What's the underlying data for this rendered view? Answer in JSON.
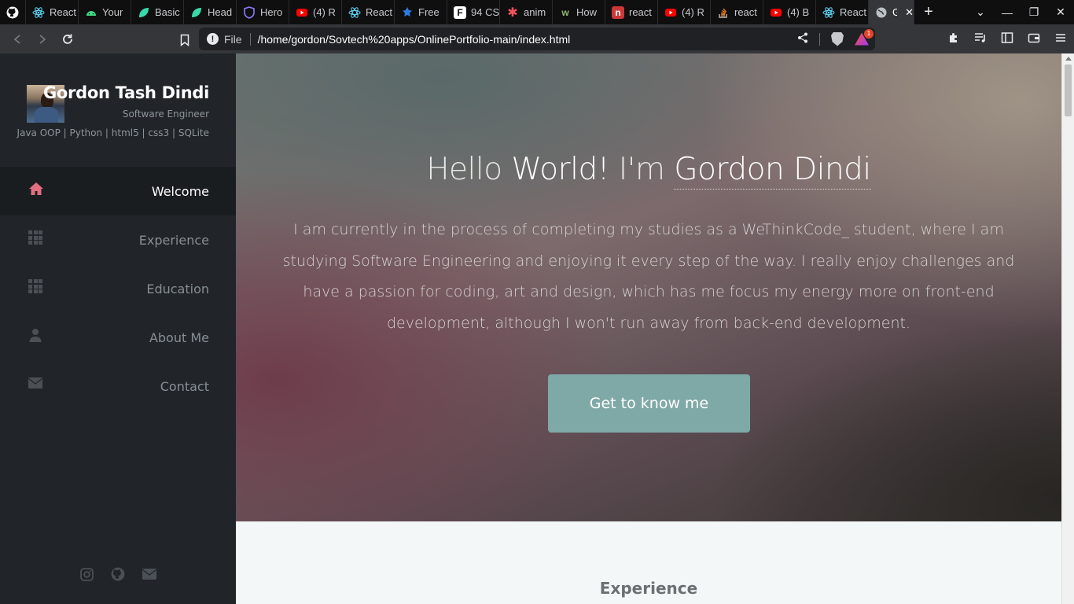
{
  "browser": {
    "tabs": [
      {
        "icon": "github-icon",
        "title": ""
      },
      {
        "icon": "react-icon",
        "title": "React"
      },
      {
        "icon": "android-icon",
        "title": "Your"
      },
      {
        "icon": "leaf-icon",
        "title": "Basic"
      },
      {
        "icon": "leaf-icon",
        "title": "Head"
      },
      {
        "icon": "shield-icon",
        "title": "Hero"
      },
      {
        "icon": "youtube-icon",
        "title": "(4) R"
      },
      {
        "icon": "react-icon",
        "title": "React"
      },
      {
        "icon": "free-icon",
        "title": "Free"
      },
      {
        "icon": "f-icon",
        "title": "94 CS"
      },
      {
        "icon": "asterisk-icon",
        "title": "anim"
      },
      {
        "icon": "wikihow-icon",
        "title": "How"
      },
      {
        "icon": "npm-icon",
        "title": "react"
      },
      {
        "icon": "youtube-icon",
        "title": "(4) R"
      },
      {
        "icon": "stackoverflow-icon",
        "title": "react"
      },
      {
        "icon": "youtube-icon",
        "title": "(4) B"
      },
      {
        "icon": "react-icon",
        "title": "React"
      },
      {
        "icon": "globe-icon",
        "title": "G",
        "active": true
      }
    ],
    "url_scheme_label": "File",
    "url": "/home/gordon/Sovtech%20apps/OnlinePortfolio-main/index.html",
    "rewards_badge": "1"
  },
  "sidebar": {
    "name": "Gordon Tash Dindi",
    "role": "Software Engineer",
    "skills": "Java OOP | Python | html5 | css3 | SQLite",
    "nav": [
      {
        "label": "Welcome",
        "icon": "home-icon",
        "active": true
      },
      {
        "label": "Experience",
        "icon": "grid-icon"
      },
      {
        "label": "Education",
        "icon": "grid-icon"
      },
      {
        "label": "About Me",
        "icon": "user-icon"
      },
      {
        "label": "Contact",
        "icon": "envelope-icon"
      }
    ],
    "socials": [
      "instagram-icon",
      "github-icon",
      "envelope-icon"
    ]
  },
  "hero": {
    "title_hello": "Hello",
    "title_world": "World!",
    "title_im": "I'm",
    "title_name": "Gordon Dindi",
    "text": "I am currently in the process of completing my studies as a WeThinkCode_ student, where I am studying Software Engineering and enjoying it every step of the way. I really enjoy challenges and have a passion for coding, art and design, which has me focus my energy more on front-end development, although I won't run away from back-end development.",
    "button": "Get to know me"
  },
  "next_section": {
    "title": "Experience"
  },
  "colors": {
    "sidebar_bg": "#212529",
    "accent_home": "#e0707f",
    "button_bg": "#7fa9a7",
    "section_bg": "#f3f7f7"
  }
}
